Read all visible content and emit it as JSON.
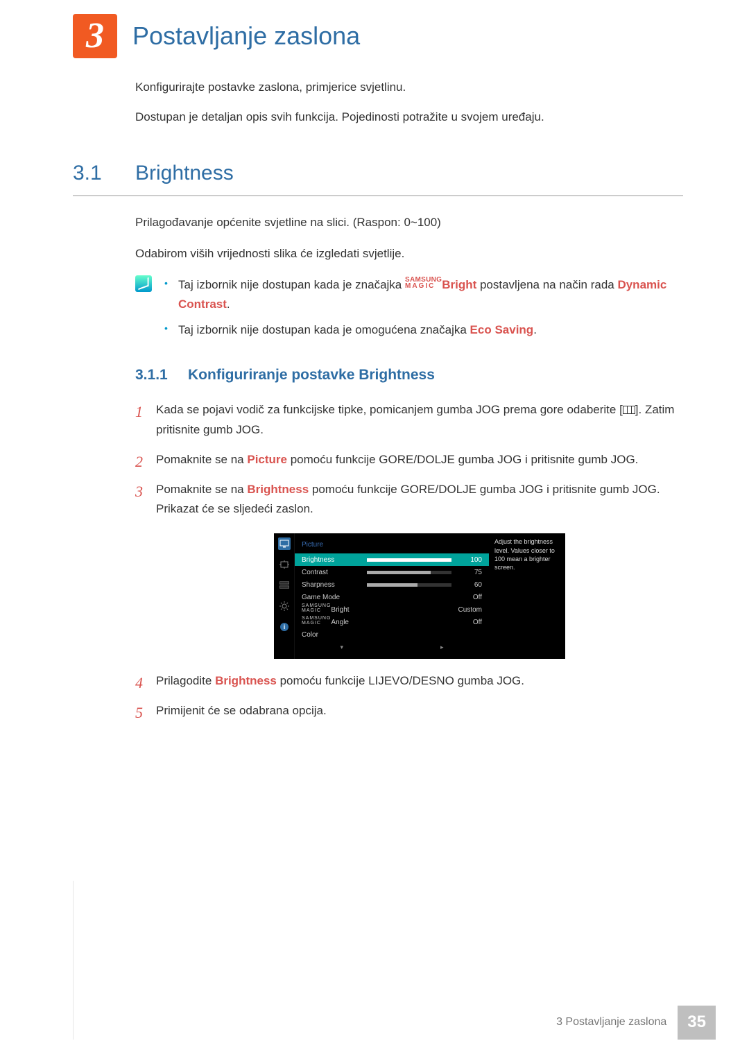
{
  "chapter": {
    "number": "3",
    "title": "Postavljanje zaslona"
  },
  "intro": {
    "p1": "Konfigurirajte postavke zaslona, primjerice svjetlinu.",
    "p2": "Dostupan je detaljan opis svih funkcija. Pojedinosti potražite u svojem uređaju."
  },
  "section": {
    "number": "3.1",
    "title": "Brightness",
    "p1": "Prilagođavanje općenite svjetline na slici. (Raspon: 0~100)",
    "p2": "Odabirom viših vrijednosti slika će izgledati svjetlije."
  },
  "notes": {
    "n1a": "Taj izbornik nije dostupan kada je značajka ",
    "n1_magic_top": "SAMSUNG",
    "n1_magic_bot": "MAGIC",
    "n1_bright": "Bright",
    "n1b": " postavljena na način rada ",
    "n1_dc": "Dynamic Contrast",
    "n1c": ".",
    "n2a": "Taj izbornik nije dostupan kada je omogućena značajka ",
    "n2_eco": "Eco Saving",
    "n2b": "."
  },
  "subsection": {
    "number": "3.1.1",
    "title": "Konfiguriranje postavke Brightness"
  },
  "steps": {
    "s1a": "Kada se pojavi vodič za funkcijske tipke, pomicanjem gumba JOG prema gore odaberite [",
    "s1b": "]. Zatim pritisnite gumb JOG.",
    "s2a": "Pomaknite se na ",
    "s2_pic": "Picture",
    "s2b": " pomoću funkcije GORE/DOLJE gumba JOG i pritisnite gumb JOG.",
    "s3a": "Pomaknite se na ",
    "s3_bri": "Brightness",
    "s3b": " pomoću funkcije GORE/DOLJE gumba JOG i pritisnite gumb JOG. Prikazat će se sljedeći zaslon.",
    "s4a": "Prilagodite ",
    "s4_bri": "Brightness",
    "s4b": " pomoću funkcije LIJEVO/DESNO gumba JOG.",
    "s5": "Primijenit će se odabrana opcija."
  },
  "osd": {
    "title": "Picture",
    "help": "Adjust the brightness level. Values closer to 100 mean a brighter screen.",
    "rows": {
      "brightness": {
        "label": "Brightness",
        "value": "100",
        "pct": 100
      },
      "contrast": {
        "label": "Contrast",
        "value": "75",
        "pct": 75
      },
      "sharpness": {
        "label": "Sharpness",
        "value": "60",
        "pct": 60
      },
      "game": {
        "label": "Game Mode",
        "value": "Off"
      },
      "mbright": {
        "suffix": "Bright",
        "value": "Custom"
      },
      "mangle": {
        "suffix": "Angle",
        "value": "Off"
      },
      "color": {
        "label": "Color"
      }
    },
    "magic_top": "SAMSUNG",
    "magic_bot": "MAGIC",
    "nav_down": "▾",
    "nav_right": "▸"
  },
  "footer": {
    "text": "3 Postavljanje zaslona",
    "page": "35"
  }
}
